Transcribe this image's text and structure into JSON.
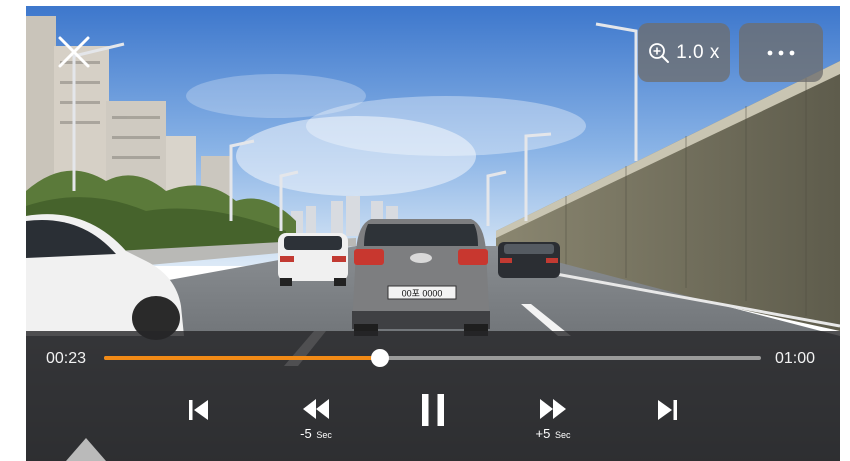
{
  "player": {
    "zoom_label": "1.0 x",
    "time_current": "00:23",
    "time_duration": "01:00",
    "progress": 0.42,
    "accent_color": "#f28a16"
  },
  "video_frame": {
    "license_plate": "00포 0000"
  },
  "controls": {
    "rewind_caption": "-5",
    "forward_caption": "+5",
    "seek_unit": "Sec"
  },
  "icons": {
    "close": "close-icon",
    "zoom": "zoom-in-icon",
    "more": "more-icon",
    "prev": "skip-previous-icon",
    "rewind": "rewind-icon",
    "pause": "pause-icon",
    "forward": "fast-forward-icon",
    "next": "skip-next-icon"
  }
}
